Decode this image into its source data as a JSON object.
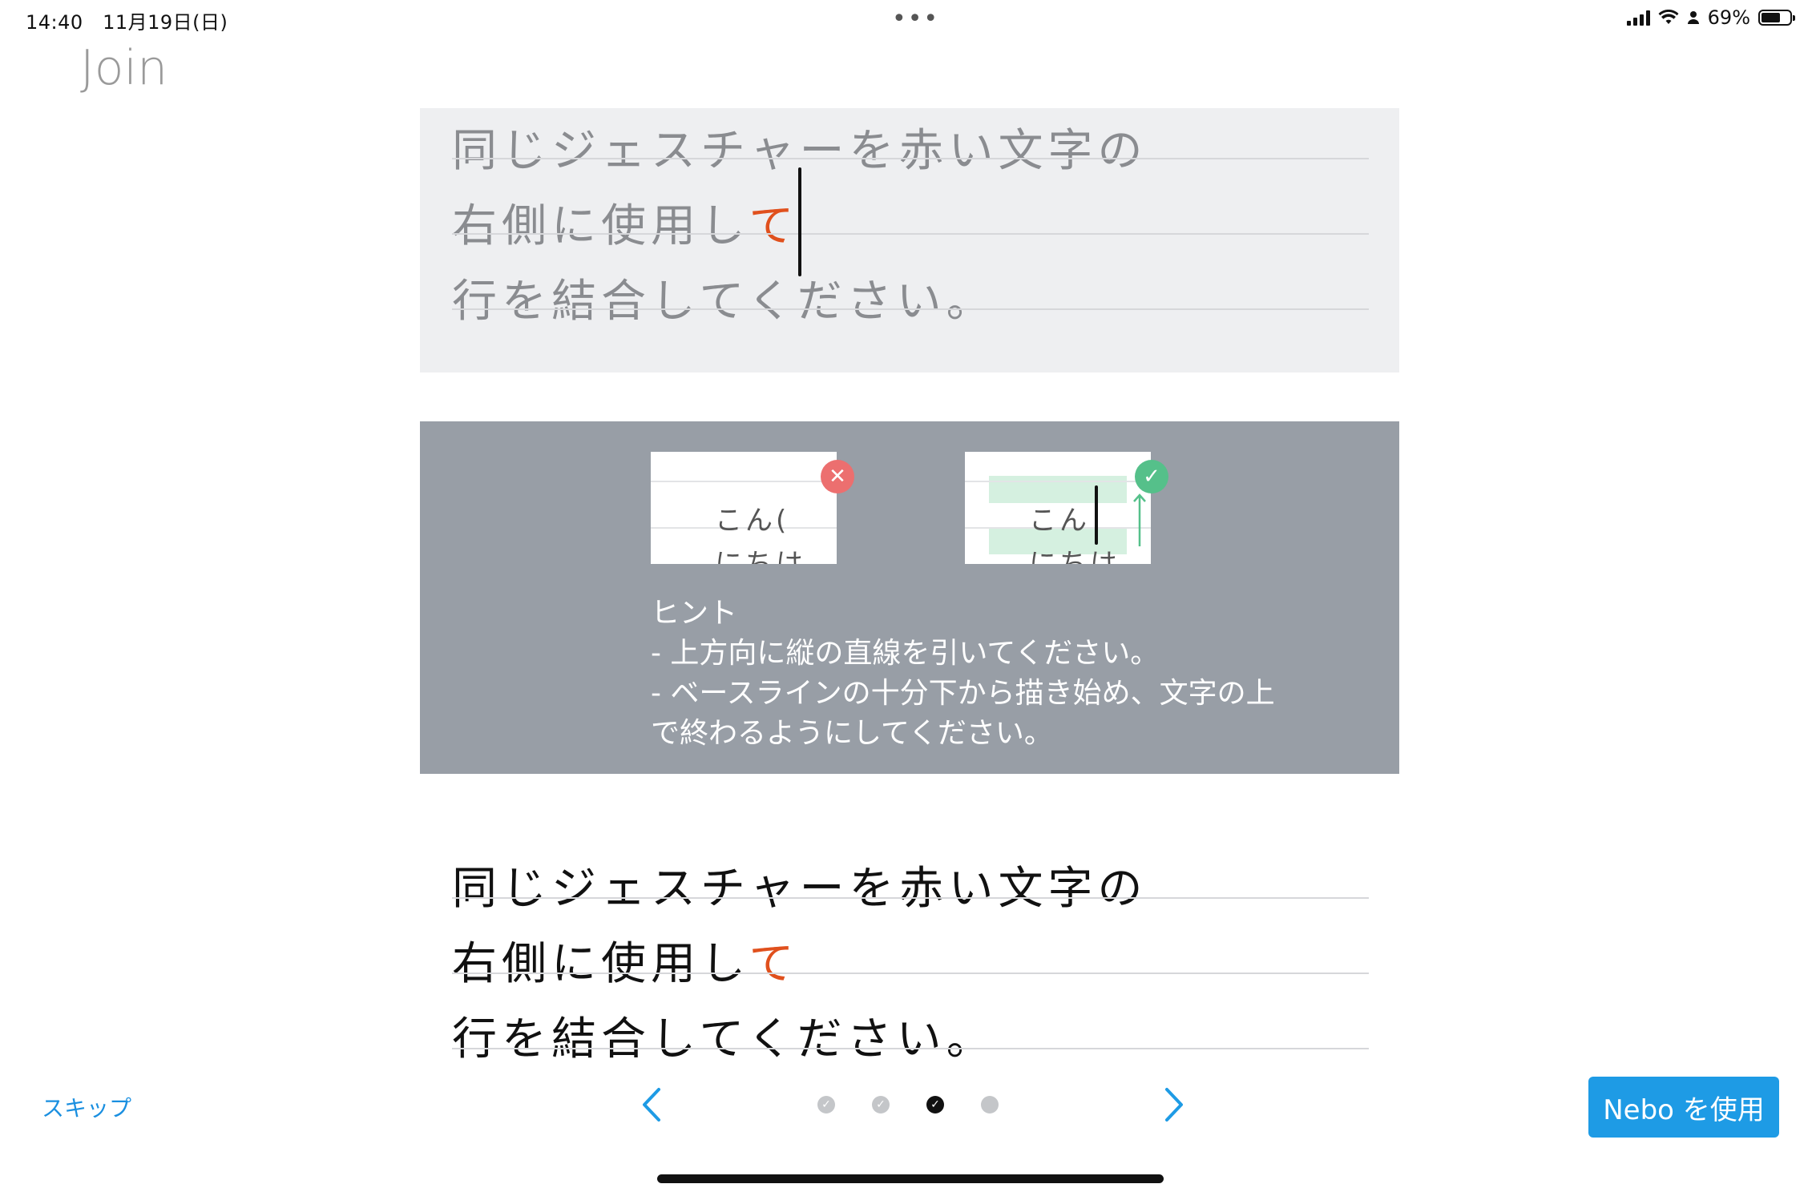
{
  "status_bar": {
    "time": "14:40",
    "date": "11月19日(日)",
    "dots": "•••",
    "battery": "69%",
    "battery_level": 0.69
  },
  "page": {
    "title": "Join"
  },
  "top_panel": {
    "lines": [
      {
        "text": "同じジェスチャーを赤い文字の",
        "highlight": ""
      },
      {
        "text": "右側に使用し",
        "highlight": "て"
      },
      {
        "text": "行を結合してください。",
        "highlight": ""
      }
    ]
  },
  "hint": {
    "thumb_wrong": {
      "line1": "こん(",
      "line2": "にちは",
      "badge_icon": "close-icon"
    },
    "thumb_right": {
      "line1": "こん",
      "line2": "にちは",
      "badge_icon": "check-icon"
    },
    "title": "ヒント",
    "line1": "- 上方向に縦の直線を引いてください。",
    "line2": "- ベースラインの十分下から描き始め、文字の上",
    "line3": "で終わるようにしてください。"
  },
  "bottom_panel": {
    "lines": [
      {
        "text": "同じジェスチャーを赤い文字の",
        "highlight": ""
      },
      {
        "text": "右側に使用し",
        "highlight": "て"
      },
      {
        "text": "行を結合してください。",
        "highlight": ""
      }
    ]
  },
  "footer": {
    "skip_label": "スキップ",
    "cta_label": "Nebo を使用",
    "pager": {
      "total": 4,
      "current": 3
    }
  },
  "colors": {
    "accent": "#1e9be5",
    "highlight_red": "#e0501d",
    "hint_bg": "#989ea6",
    "error_badge": "#ec6f6f",
    "success_badge": "#55c08a"
  }
}
